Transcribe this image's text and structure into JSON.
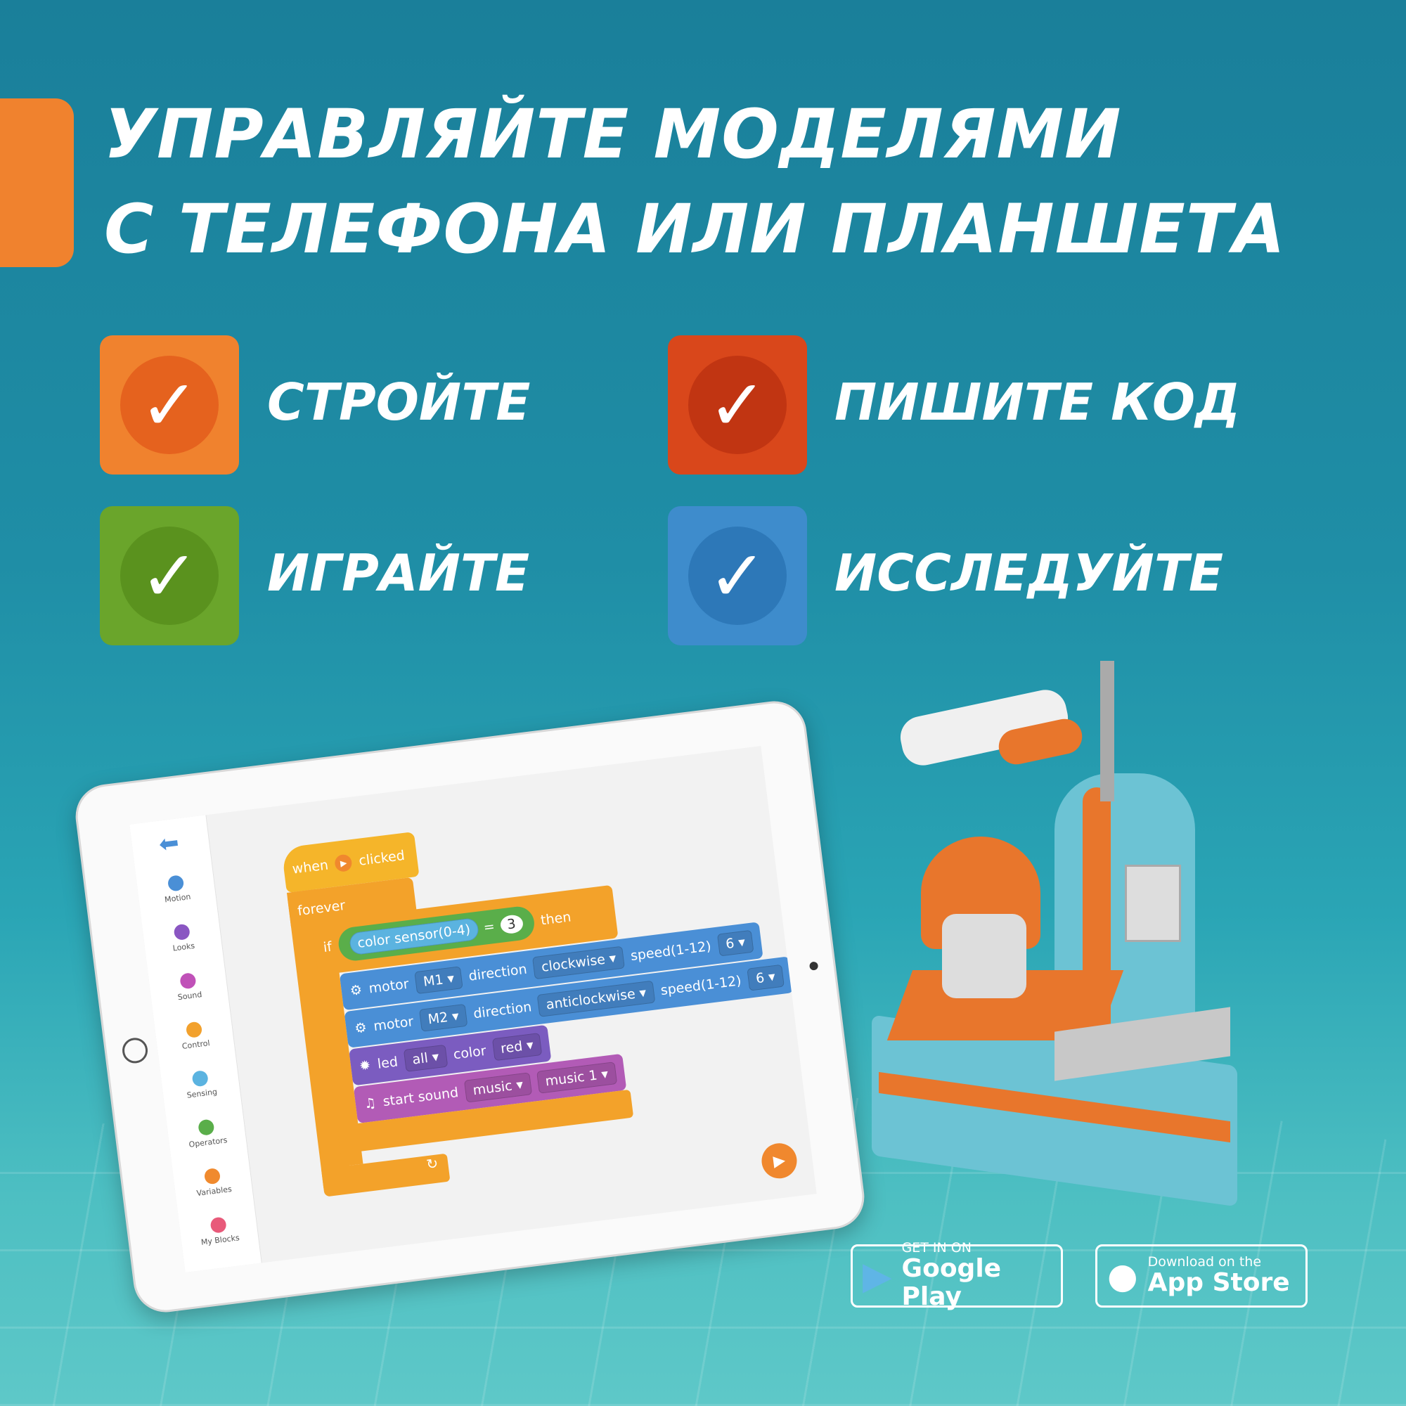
{
  "headline": {
    "line1": "УПРАВЛЯЙТЕ МОДЕЛЯМИ",
    "line2": "С ТЕЛЕФОНА ИЛИ ПЛАНШЕТА"
  },
  "features": [
    {
      "label": "СТРОЙТЕ",
      "color": "#f0822e",
      "icon": "check-icon"
    },
    {
      "label": "ПИШИТЕ КОД",
      "color": "#d9471b",
      "icon": "check-icon"
    },
    {
      "label": "ИГРАЙТЕ",
      "color": "#6aa52b",
      "icon": "check-icon"
    },
    {
      "label": "ИССЛЕДУЙТЕ",
      "color": "#3e8ccc",
      "icon": "check-icon"
    }
  ],
  "check_glyph": "✓",
  "app": {
    "categories": [
      {
        "label": "Motion",
        "color": "#4a8fd6"
      },
      {
        "label": "Looks",
        "color": "#8a56c2"
      },
      {
        "label": "Sound",
        "color": "#c051b8"
      },
      {
        "label": "Control",
        "color": "#f2a12d"
      },
      {
        "label": "Sensing",
        "color": "#5bb3e0"
      },
      {
        "label": "Operators",
        "color": "#5aae4a"
      },
      {
        "label": "Variables",
        "color": "#f08a2e"
      },
      {
        "label": "My Blocks",
        "color": "#e85a7a"
      }
    ],
    "blocks": {
      "when": "when",
      "clicked": "clicked",
      "forever": "forever",
      "if": "if",
      "sensor": "color sensor(0-4)",
      "eq": "=",
      "value": "3",
      "then": "then",
      "motor": "motor",
      "m1": "M1 ▾",
      "m2": "M2 ▾",
      "direction": "direction",
      "clockwise": "clockwise ▾",
      "anticlockwise": "anticlockwise ▾",
      "speed": "speed(1-12)",
      "speed_val": "6 ▾",
      "led": "led",
      "all": "all ▾",
      "color": "color",
      "red": "red ▾",
      "start_sound": "start sound",
      "music": "music ▾",
      "music1": "music 1 ▾"
    }
  },
  "stores": {
    "google": {
      "small": "GET IN ON",
      "big": "Google Play"
    },
    "apple": {
      "small": "Download on the",
      "big": "App Store"
    }
  }
}
